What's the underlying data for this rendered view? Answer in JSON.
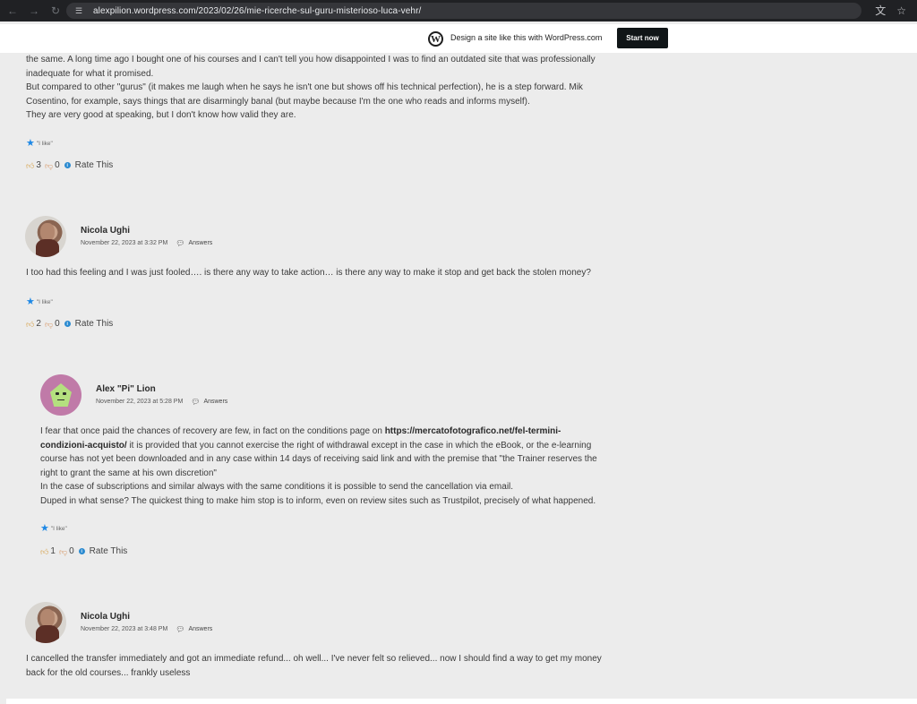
{
  "browser": {
    "url": "alexpilion.wordpress.com/2023/02/26/mie-ricerche-sul-guru-misterioso-luca-vehr/",
    "icons": {
      "back": "arrow-left-icon",
      "forward": "arrow-right-icon",
      "reload": "reload-icon",
      "site_info": "site-info-icon",
      "translate": "translate-icon",
      "bookmark": "star-icon"
    }
  },
  "banner": {
    "text": "Design a site like this with WordPress.com",
    "button": "Start now"
  },
  "top_comment": {
    "lines": [
      "the same. A long time ago I bought one of his courses and I can't tell you how disappointed I was to find an outdated site that was professionally",
      "inadequate for what it promised.",
      "But compared to other \"gurus\" (it makes me laugh when he says he isn't one but shows off his technical perfection), he is a step forward. Mik",
      "Cosentino, for example, says things that are disarmingly banal (but maybe because I'm the one who reads and informs myself).",
      "They are very good at speaking, but I don't know how valid they are."
    ],
    "like_label": "\"I like\"",
    "thumbs_up": "3",
    "thumbs_down": "0",
    "rate_label": "Rate This"
  },
  "comments": [
    {
      "author": "Nicola Ughi",
      "date": "November 22, 2023 at 3:32 PM",
      "reply_label": "Answers",
      "text": "I too had this feeling and I was just fooled…. is there any way to take action… is there any way to make it stop and get back the stolen money?",
      "like_label": "\"I like\"",
      "thumbs_up": "2",
      "thumbs_down": "0",
      "rate_label": "Rate This"
    },
    {
      "author": "Alex \"Pi\" Lion",
      "date": "November 22, 2023 at 5:28 PM",
      "reply_label": "Answers",
      "line1_a": "I fear that once paid the chances of recovery are few, in fact on the conditions page on ",
      "line1_link": "https://mercatofotografico.net/fel-termini-",
      "line2_link": "condizioni-acquisto/",
      "line2_b": " it is provided that you cannot exercise the right of withdrawal except in the case in which the eBook, or the e-learning",
      "line3": "course has not yet been downloaded and in any case within 14 days of receiving said link and with the premise that \"the Trainer reserves the",
      "line4": "right to grant the same at his own discretion\"",
      "line5": "In the case of subscriptions and similar always with the same conditions it is possible to send the cancellation via email.",
      "line6": "Duped in what sense? The quickest thing to make him stop is to inform, even on review sites such as Trustpilot, precisely of what happened.",
      "like_label": "\"I like\"",
      "thumbs_up": "1",
      "thumbs_down": "0",
      "rate_label": "Rate This"
    },
    {
      "author": "Nicola Ughi",
      "date": "November 22, 2023 at 3:48 PM",
      "reply_label": "Answers",
      "line1": "I cancelled the transfer immediately and got an immediate refund... oh well... I've never felt so relieved... now I should find a way to get my money",
      "line2": "back for the old courses... frankly useless"
    }
  ]
}
